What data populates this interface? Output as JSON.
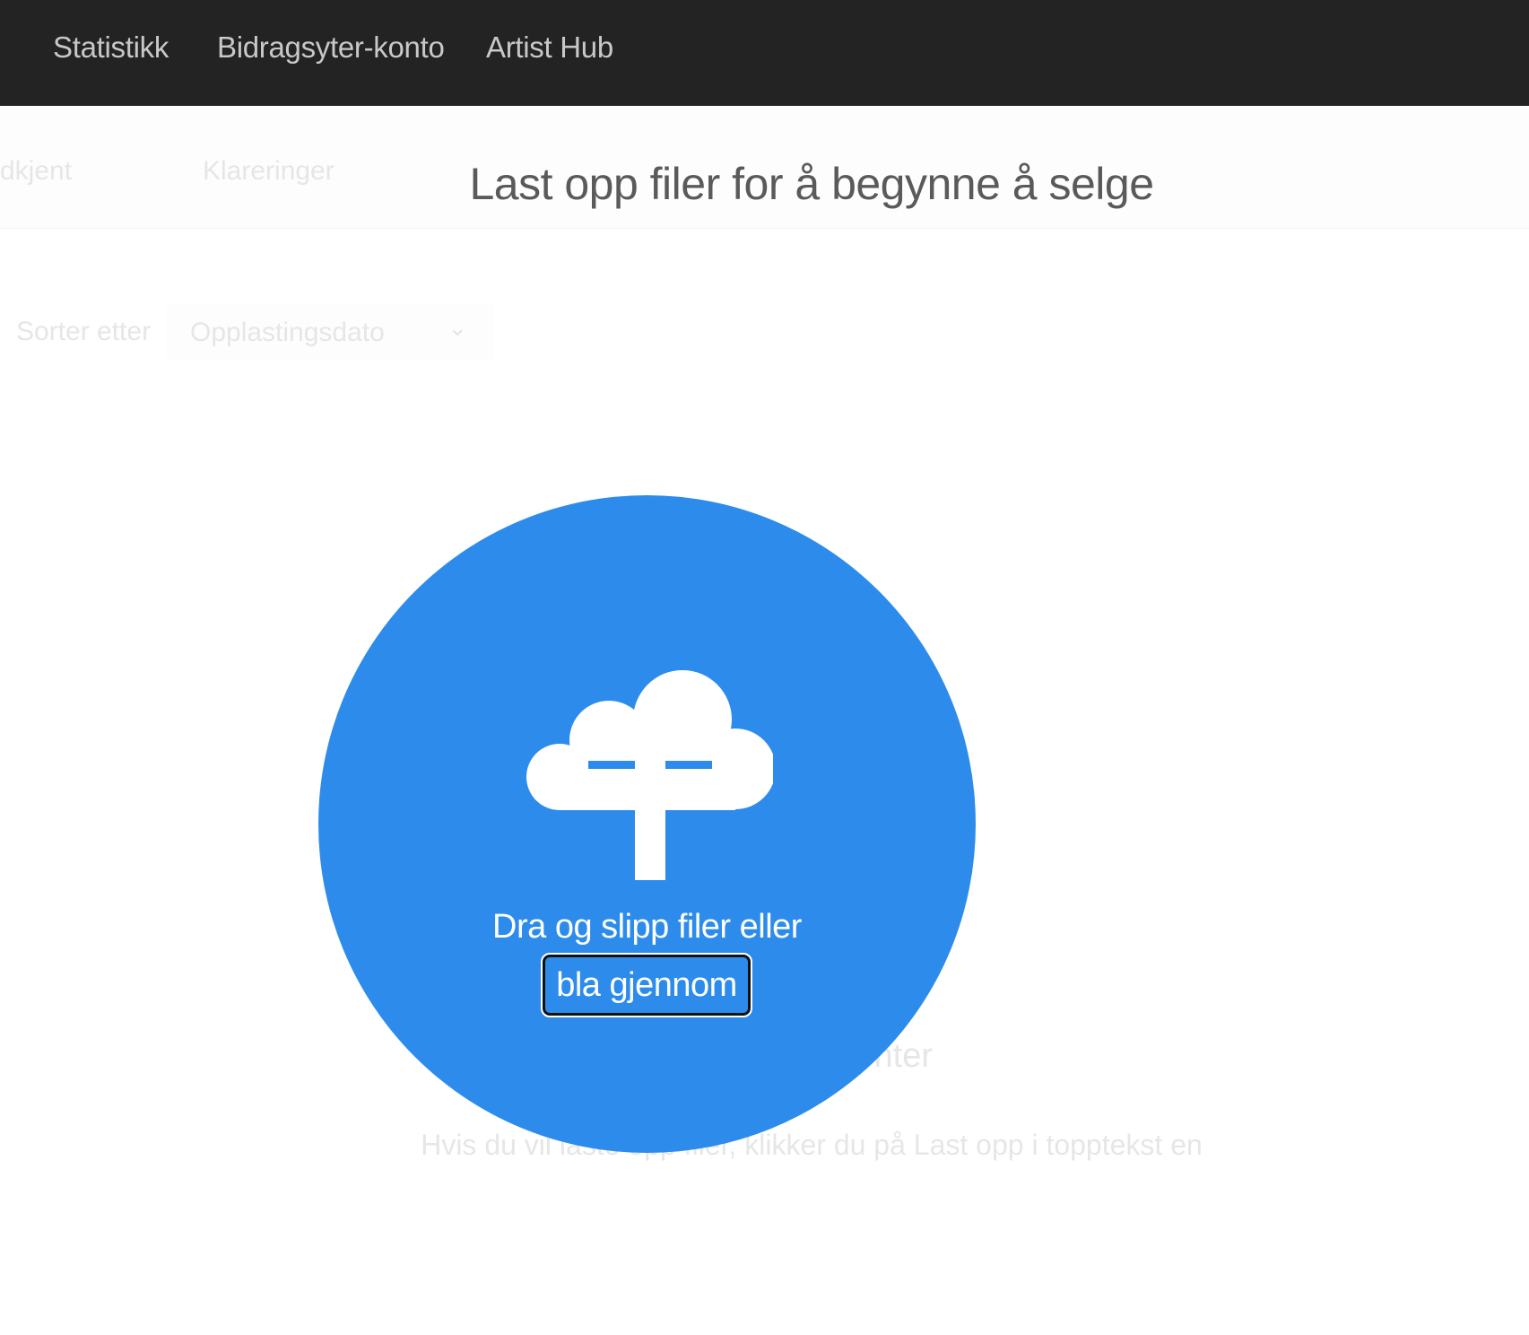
{
  "topnav": {
    "items": [
      {
        "label": "Statistikk"
      },
      {
        "label": "Bidragsyter-konto"
      },
      {
        "label": "Artist Hub"
      }
    ]
  },
  "background": {
    "tabs": [
      {
        "label": "dkjent"
      },
      {
        "label": "Klareringer"
      }
    ],
    "sort": {
      "label": "Sorter etter",
      "value": "Opplastingsdato"
    },
    "empty_title_fragment": "nter",
    "empty_hint": "Hvis du vil laste opp filer, klikker du på Last opp i topptekst en"
  },
  "upload": {
    "title": "Last opp filer for å begynne å selge",
    "drop_text": "Dra og slipp filer eller",
    "browse_label": "bla gjennom",
    "icon": "cloud-upload-icon",
    "accent_color": "#2d8ceb"
  }
}
